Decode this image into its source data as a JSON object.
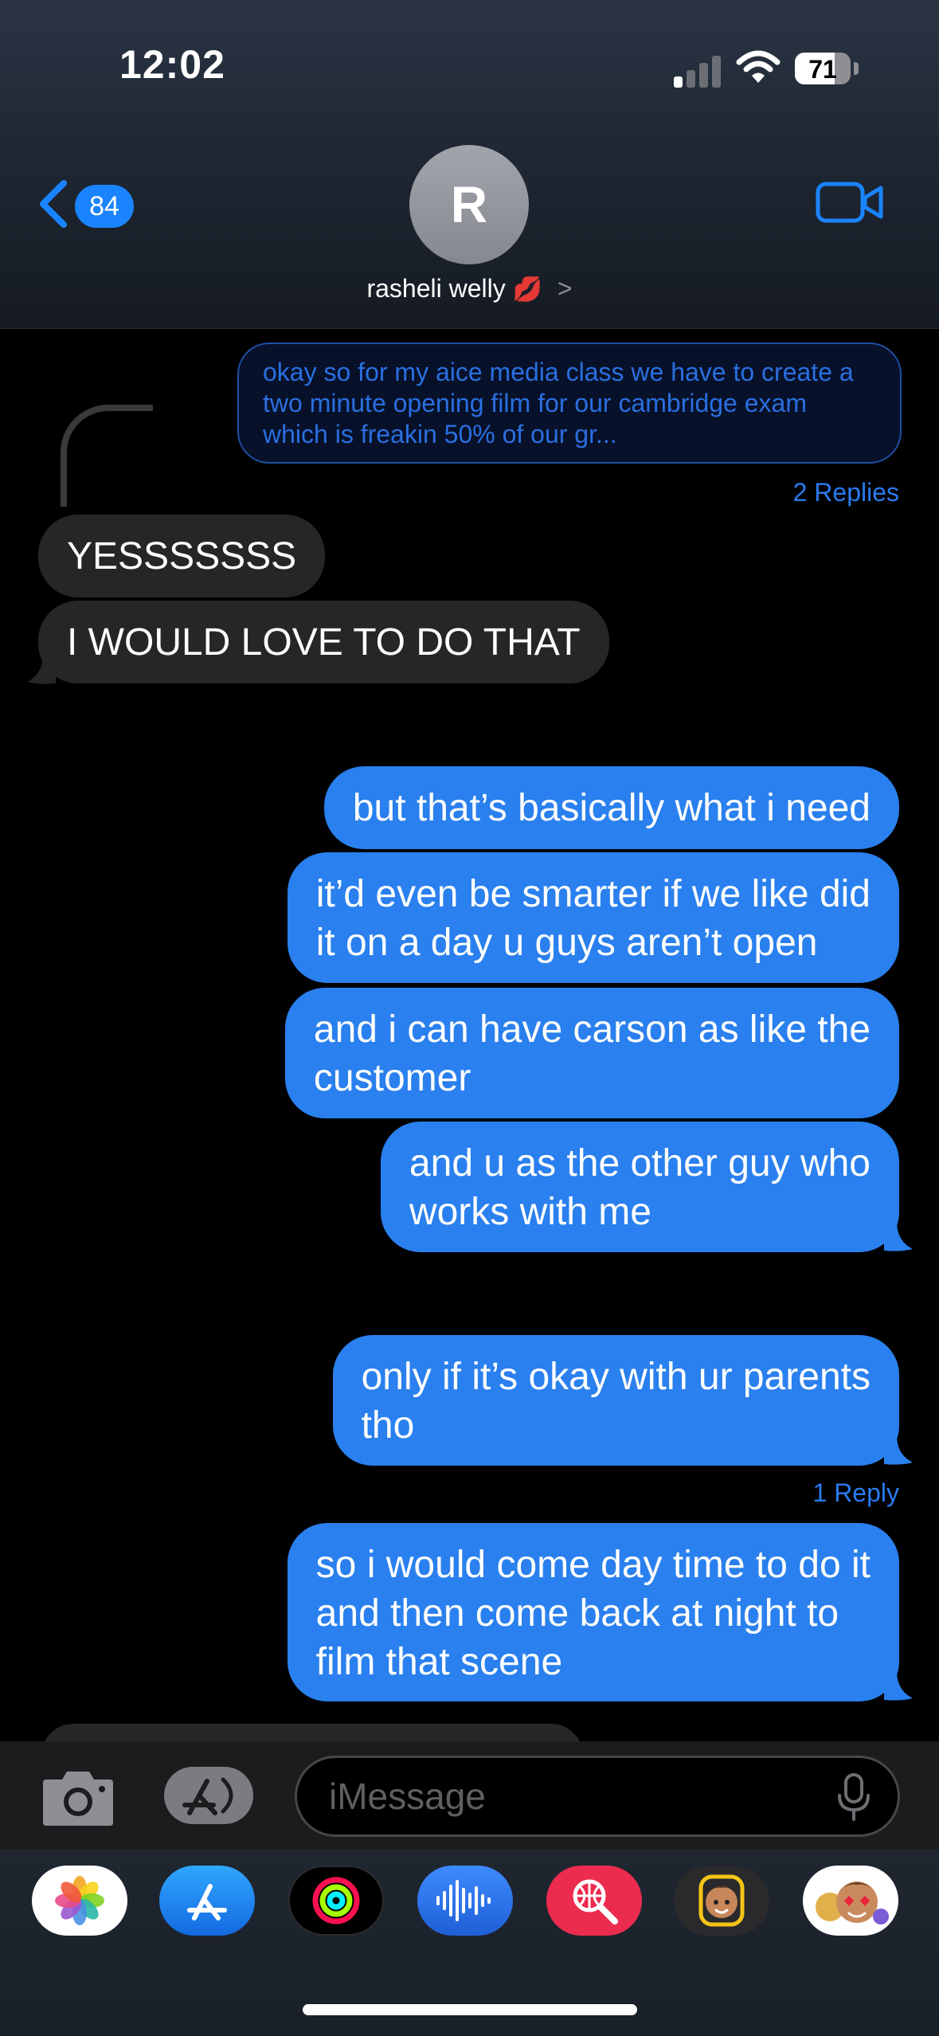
{
  "status_bar": {
    "time": "12:02",
    "battery": "71"
  },
  "header": {
    "back_badge": "84",
    "avatar_initial": "R",
    "contact_name": "rasheli welly",
    "contact_emoji": "💋",
    "chevron": ">"
  },
  "thread": {
    "quoted_message": "okay so for my aice media class we have to create a two minute opening film  for our cambridge exam which is freakin 50% of our gr...",
    "replies_label_1": "2 Replies",
    "replies_label_2": "1 Reply"
  },
  "messages": [
    {
      "direction": "incoming",
      "text": "YESSSSSSS"
    },
    {
      "direction": "incoming",
      "text": "I WOULD LOVE TO DO THAT"
    },
    {
      "direction": "outgoing",
      "text": "but that’s basically what i need"
    },
    {
      "direction": "outgoing",
      "text": "it’d even be smarter if we like did\nit on a day u guys aren’t open"
    },
    {
      "direction": "outgoing",
      "text": "and i can have carson as like the\ncustomer"
    },
    {
      "direction": "outgoing",
      "text": "and u as the other guy who\nworks with me"
    },
    {
      "direction": "outgoing",
      "text": "only if it’s okay with ur parents\ntho"
    },
    {
      "direction": "outgoing",
      "text": "so i would come day time to do it\nand then come back at night to\nfilm that scene"
    }
  ],
  "composer": {
    "placeholder": "iMessage"
  },
  "app_drawer": [
    "photos-icon",
    "app-store-icon",
    "activity-icon",
    "audio-message-icon",
    "image-search-icon",
    "memoji-icon",
    "memoji-stickers-icon"
  ],
  "colors": {
    "outgoing_bubble": "#2a80ee",
    "incoming_bubble": "#262629",
    "accent": "#1a84ff"
  }
}
